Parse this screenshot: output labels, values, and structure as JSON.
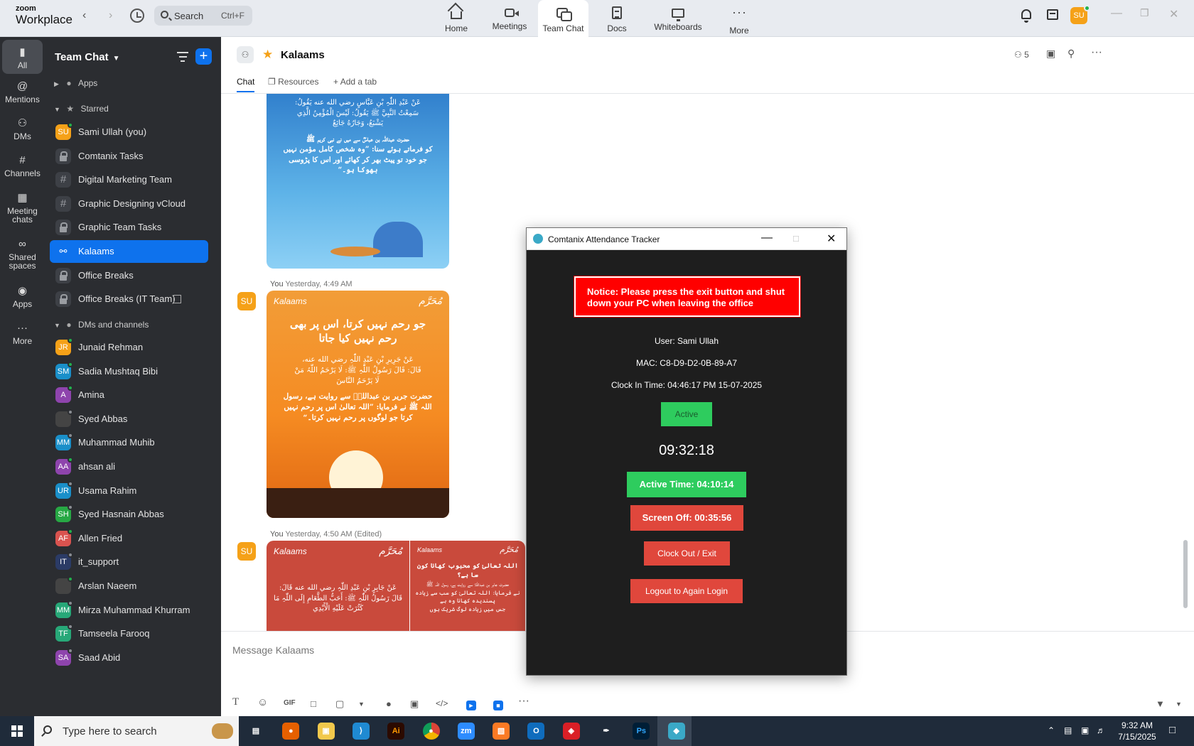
{
  "app": {
    "logo_small": "zoom",
    "logo_big": "Workplace",
    "search_placeholder": "Search",
    "search_shortcut": "Ctrl+F",
    "user_initials": "SU"
  },
  "nav_tabs": [
    {
      "label": "Home",
      "icon": "home-icon"
    },
    {
      "label": "Meetings",
      "icon": "video-camera-icon"
    },
    {
      "label": "Team Chat",
      "icon": "chat-icon",
      "active": true
    },
    {
      "label": "Docs",
      "icon": "document-icon"
    },
    {
      "label": "Whiteboards",
      "icon": "whiteboard-icon"
    },
    {
      "label": "More",
      "icon": "more-icon"
    }
  ],
  "rail": [
    {
      "label": "All",
      "icon": "chat-bubble-icon",
      "active": true
    },
    {
      "label": "Mentions",
      "icon": "at-icon"
    },
    {
      "label": "DMs",
      "icon": "people-icon"
    },
    {
      "label": "Channels",
      "icon": "hash-icon"
    },
    {
      "label": "Meeting chats",
      "icon": "calendar-icon"
    },
    {
      "label": "Shared spaces",
      "icon": "share-icon"
    },
    {
      "label": "Apps",
      "icon": "apps-icon"
    },
    {
      "label": "More",
      "icon": "more-icon"
    }
  ],
  "sidebar": {
    "title": "Team Chat",
    "apps_label": "Apps",
    "starred_label": "Starred",
    "dms_label": "DMs and channels",
    "starred": [
      {
        "label": "Sami Ullah (you)",
        "initials": "SU",
        "color": "#f5a118",
        "status": "on"
      },
      {
        "label": "Comtanix Tasks",
        "kind": "lock"
      },
      {
        "label": "Digital Marketing Team",
        "kind": "hash"
      },
      {
        "label": "Graphic Designing vCloud",
        "kind": "hash"
      },
      {
        "label": "Graphic Team Tasks",
        "kind": "lock"
      },
      {
        "label": "Kalaams",
        "kind": "group",
        "active": true
      },
      {
        "label": "Office Breaks",
        "kind": "lock"
      },
      {
        "label": "Office Breaks (IT Team)",
        "kind": "lock"
      }
    ],
    "dms": [
      {
        "label": "Junaid Rehman",
        "initials": "JR",
        "color": "#f5a118",
        "status": "on"
      },
      {
        "label": "Sadia Mushtaq Bibi",
        "initials": "SM",
        "color": "#1a8fc9",
        "status": "on"
      },
      {
        "label": "Amina",
        "initials": "A",
        "color": "#8e44ad",
        "status": "on"
      },
      {
        "label": "Syed Abbas",
        "initials": "",
        "color": "#444",
        "status": "off"
      },
      {
        "label": "Muhammad Muhib",
        "initials": "MM",
        "color": "#1a8fc9",
        "status": "off"
      },
      {
        "label": "ahsan ali",
        "initials": "AA",
        "color": "#8e44ad",
        "status": "on"
      },
      {
        "label": "Usama Rahim",
        "initials": "UR",
        "color": "#1a8fc9",
        "status": "off"
      },
      {
        "label": "Syed Hasnain Abbas",
        "initials": "SH",
        "color": "#27a844",
        "status": "off"
      },
      {
        "label": "Allen Fried",
        "initials": "AF",
        "color": "#d9534f",
        "status": "on"
      },
      {
        "label": "it_support",
        "initials": "IT",
        "color": "#2b3b66",
        "status": "off"
      },
      {
        "label": "Arslan Naeem",
        "initials": "",
        "color": "#444",
        "status": "on"
      },
      {
        "label": "Mirza Muhammad Khurram",
        "initials": "MM",
        "color": "#27a878",
        "status": "off"
      },
      {
        "label": "Tamseela Farooq",
        "initials": "TF",
        "color": "#27a878",
        "status": "off"
      },
      {
        "label": "Saad Abid",
        "initials": "SA",
        "color": "#8e44ad",
        "status": "off"
      }
    ]
  },
  "chat": {
    "name": "Kalaams",
    "member_count": "5",
    "tabs": [
      "Chat",
      "Resources",
      "Add a tab"
    ],
    "messages": [
      {
        "author": "You",
        "time": "Yesterday, 4:49 AM",
        "initials": "SU"
      },
      {
        "author": "You",
        "time": "Yesterday, 4:50 AM (Edited)",
        "initials": "SU"
      }
    ],
    "card1_lines": [
      "عَنْ عَبْدِ اللّٰہِ بْنِ عَبَّاسٍ رضي الله عنه يَقُولُ:",
      "سَمِعْتُ النَّبِيَّ ﷺ يَقُولُ: لَيْسَ الْمُؤْمِنُ الَّذِي",
      "يَشْبَعُ، وَجَارُهُ جَائِعٌ",
      "حضرت عبداللہ بن عباسؓ سے میں نے نبی کریم ﷺ",
      "کو فرماتے ہوئے سنا: ”وہ شخص کامل مؤمن نہیں",
      "جو خود تو پیٹ بھر کر کھائے اور اس کا پڑوسی",
      "بھوکا ہو۔“"
    ],
    "card2_lines": [
      "جو رحم نہیں کرتا، اس پر بھی",
      "رحم نہیں کیا جاتا",
      "عَنْ جَرِيرِ بْنِ عَبْدِ اللّٰہِ رضي الله عنه،",
      "قَالَ: قَالَ رَسُولُ اللّٰہِ ﷺ: لَا يَرْحَمُ اللّٰہُ مَنْ",
      "لَا يَرْحَمُ النَّاسَ",
      "حضرت جریر بن عبداللہؓ سے روایت ہے، رسول",
      "اللہ ﷺ نے فرمایا: ”اللہ تعالیٰ اس پر رحم نہیں",
      "کرتا جو لوگوں پر رحم نہیں کرتا۔“"
    ],
    "card3_lines": [
      "عَنْ جَابِرٍ بْنِ عَبْدِ اللّٰہِ رضي الله عنه قَالَ:",
      "قَالَ رَسُولُ اللّٰہِ ﷺ: أَحَبُّ الطَّعَامِ إِلَى اللّٰہِ مَا",
      "كَثُرَتْ عَلَيْهِ الْأَيْدِي"
    ],
    "card4_lines": [
      "اللہ تعالیٰ کو محبوب کھانا کون سا ہے؟",
      "حضرت جابر بن عبداللہؓ سے روایت ہے، رسول اللہ ﷺ",
      "نے فرمایا: اللہ تعالیٰ کو سب سے زیادہ پسندیدہ کھانا وہ ہے",
      "جس میں زیادہ لوگ شریک ہوں"
    ],
    "card_brand": "Kalaams",
    "card_brand_ar": "مُحَرَّم",
    "composer_placeholder": "Message Kalaams",
    "composer_gif": "GIF"
  },
  "attendance": {
    "title": "Comtanix Attendance Tracker",
    "notice": "Notice: Please press the exit button and shut down your PC when leaving the office",
    "user": "User: Sami Ullah",
    "mac": "MAC: C8-D9-D2-0B-89-A7",
    "clock_in": "Clock In Time: 04:46:17 PM 15-07-2025",
    "status": "Active",
    "timer": "09:32:18",
    "active_time": "Active Time: 04:10:14",
    "screen_off": "Screen Off: 00:35:56",
    "clock_out": "Clock Out / Exit",
    "logout": "Logout to Again Login",
    "colors": {
      "notice": "#ff0000",
      "green": "#2ecc5e",
      "red": "#e0473c"
    }
  },
  "taskbar": {
    "search_placeholder": "Type here to search",
    "time": "9:32 AM",
    "date": "7/15/2025",
    "apps": [
      {
        "name": "task-view-icon",
        "label": ""
      },
      {
        "name": "firefox-icon",
        "label": ""
      },
      {
        "name": "file-explorer-icon",
        "label": ""
      },
      {
        "name": "vscode-icon",
        "label": ""
      },
      {
        "name": "illustrator-icon",
        "label": "Ai"
      },
      {
        "name": "chrome-icon",
        "label": ""
      },
      {
        "name": "zoom-icon",
        "label": "zm"
      },
      {
        "name": "xampp-icon",
        "label": ""
      },
      {
        "name": "outlook-icon",
        "label": ""
      },
      {
        "name": "creative-cloud-icon",
        "label": ""
      },
      {
        "name": "pen-tool-icon",
        "label": ""
      },
      {
        "name": "photoshop-icon",
        "label": "Ps"
      },
      {
        "name": "attendance-tracker-icon",
        "label": ""
      }
    ]
  }
}
